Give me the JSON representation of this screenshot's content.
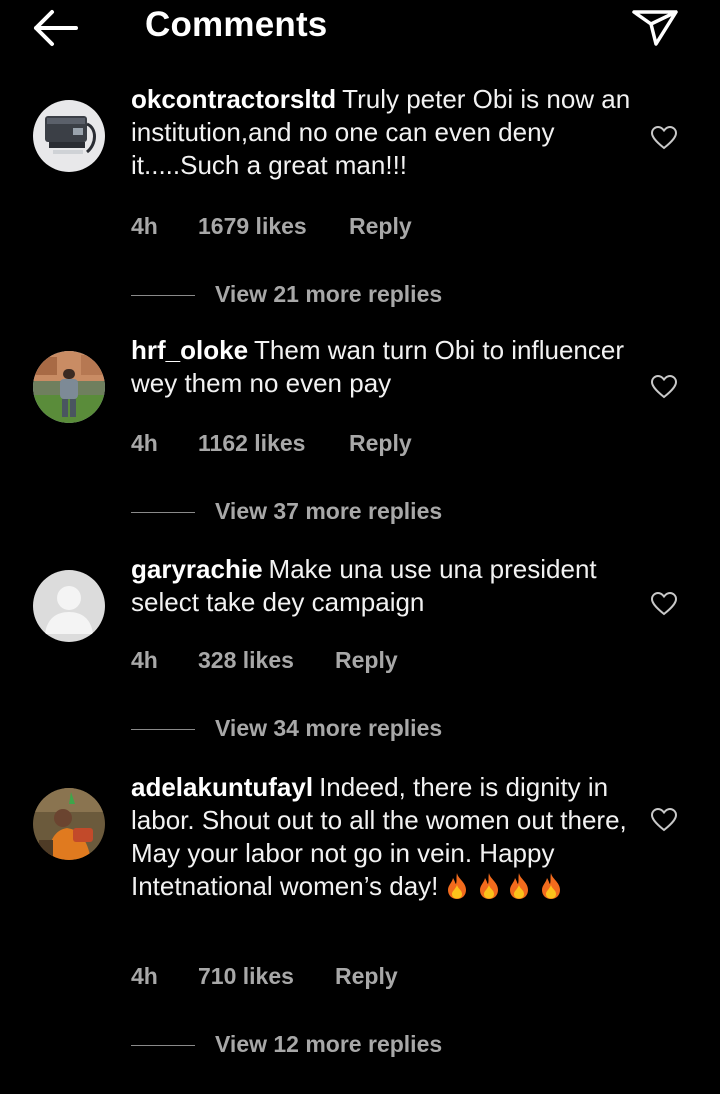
{
  "header": {
    "title": "Comments",
    "back_icon": "arrow-left-icon",
    "share_icon": "paper-plane-icon"
  },
  "comments": [
    {
      "username": "okcontractorsltd",
      "text": "Truly peter Obi is now an institution,and no one can even deny it.....Such a great man!!!",
      "time": "4h",
      "likes": "1679 likes",
      "reply": "Reply",
      "view_replies": "View 21 more replies"
    },
    {
      "username": "hrf_oloke",
      "text": "Them wan turn Obi to influencer wey them no even pay",
      "time": "4h",
      "likes": "1162 likes",
      "reply": "Reply",
      "view_replies": "View 37 more replies"
    },
    {
      "username": "garyrachie",
      "text": "Make una use una president select take dey campaign",
      "time": "4h",
      "likes": "328 likes",
      "reply": "Reply",
      "view_replies": "View 34 more replies"
    },
    {
      "username": "adelakuntufayl",
      "text": "Indeed, there is dignity in labor.  Shout out to all the women out there, May your labor not go in vein. Happy Intetnational women’s day!",
      "time": "4h",
      "likes": "710 likes",
      "reply": "Reply",
      "view_replies": "View 12 more replies"
    }
  ],
  "colors": {
    "background": "#000000",
    "text": "#ffffff",
    "muted": "#a8a8a8"
  }
}
